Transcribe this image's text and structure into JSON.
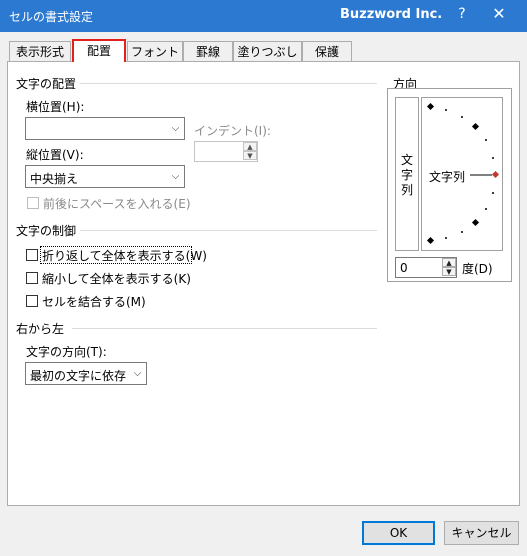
{
  "window": {
    "title": "セルの書式設定",
    "company": "Buzzword Inc.",
    "help": "?",
    "close": "✕"
  },
  "tabs": [
    {
      "label": "表示形式"
    },
    {
      "label": "配置"
    },
    {
      "label": "フォント"
    },
    {
      "label": "罫線"
    },
    {
      "label": "塗りつぶし"
    },
    {
      "label": "保護"
    }
  ],
  "alignment": {
    "section": "文字の配置",
    "horizontal_label": "横位置(H):",
    "horizontal_value": "",
    "indent_label": "インデント(I):",
    "indent_value": "",
    "vertical_label": "縦位置(V):",
    "vertical_value": "中央揃え",
    "distributed_label": "前後にスペースを入れる(E)"
  },
  "text_control": {
    "section": "文字の制御",
    "wrap_label": "折り返して全体を表示する(W)",
    "shrink_label": "縮小して全体を表示する(K)",
    "merge_label": "セルを結合する(M)"
  },
  "rtl": {
    "section": "右から左",
    "direction_label": "文字の方向(T):",
    "direction_value": "最初の文字に依存"
  },
  "orientation": {
    "section": "方向",
    "vertical_text": [
      "文",
      "字",
      "列"
    ],
    "dial_text": "文字列",
    "degree_value": "0",
    "degree_label": "度(D)"
  },
  "buttons": {
    "ok": "OK",
    "cancel": "キャンセル"
  },
  "colors": {
    "titlebar": "#2b79d0",
    "active_tab_border": "#e0211d",
    "dial_marker": "#c0392b",
    "default_button": "#0078d7"
  }
}
